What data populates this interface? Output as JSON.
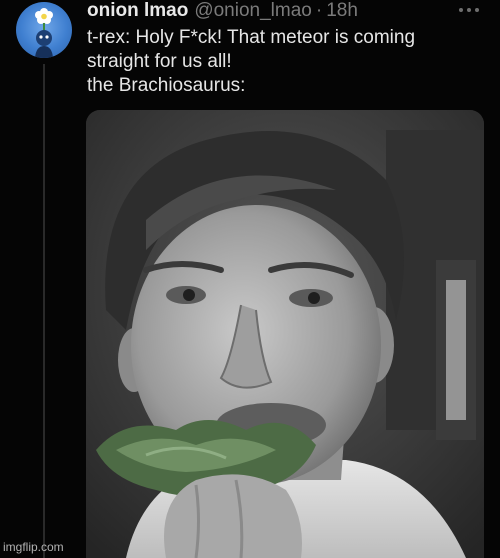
{
  "tweet": {
    "display_name": "onion lmao",
    "handle": "@onion_lmao",
    "separator": "·",
    "time": "18h",
    "text_lines": [
      "t-rex: Holy F*ck! That meteor is coming",
      "straight for us all!",
      "the Brachiosaurus:"
    ],
    "avatar_icon": "flower-character-icon",
    "more_icon": "more-options-icon"
  },
  "media": {
    "description_icon": "man-eating-lettuce-photo"
  },
  "watermark": "imgflip.com",
  "colors": {
    "background": "#050505",
    "name": "#e9e9e9",
    "muted": "#7b7b7b",
    "avatar": "#3f7fd0"
  }
}
